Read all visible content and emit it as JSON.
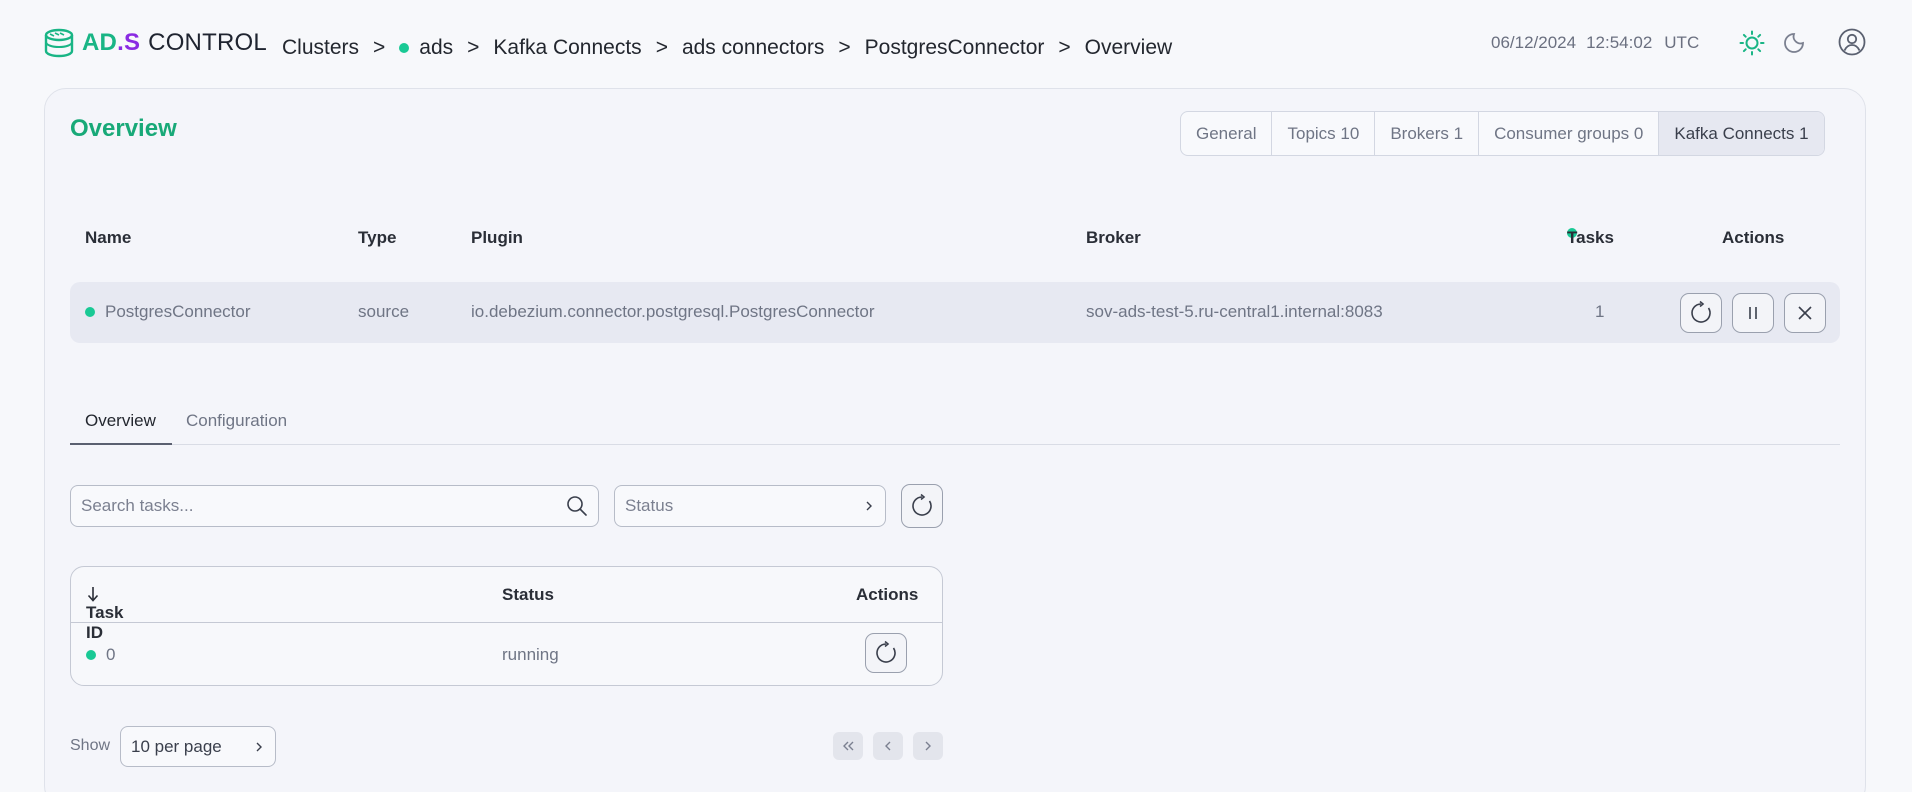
{
  "app": {
    "logo_ad": "AD",
    "logo_s": ".S",
    "logo_control": "CONTROL"
  },
  "breadcrumb": {
    "items": [
      "Clusters",
      "ads",
      "Kafka Connects",
      "ads connectors",
      "PostgresConnector",
      "Overview"
    ],
    "separator": ">"
  },
  "header": {
    "date": "06/12/2024",
    "time": "12:54:02",
    "timezone": "UTC"
  },
  "page": {
    "title": "Overview"
  },
  "segments": [
    {
      "label": "General"
    },
    {
      "label": "Topics 10"
    },
    {
      "label": "Brokers 1"
    },
    {
      "label": "Consumer groups 0"
    },
    {
      "label": "Kafka Connects 1"
    }
  ],
  "connector_table": {
    "headers": {
      "name": "Name",
      "type": "Type",
      "plugin": "Plugin",
      "broker": "Broker",
      "tasks": "Tasks",
      "actions": "Actions"
    },
    "row": {
      "name": "PostgresConnector",
      "type": "source",
      "plugin": "io.debezium.connector.postgresql.PostgresConnector",
      "broker": "sov-ads-test-5.ru-central1.internal:8083",
      "tasks": "1"
    }
  },
  "tabs": {
    "overview": "Overview",
    "configuration": "Configuration"
  },
  "filters": {
    "search_placeholder": "Search tasks...",
    "status_placeholder": "Status"
  },
  "tasks_table": {
    "headers": {
      "task_id": "Task ID",
      "status": "Status",
      "actions": "Actions"
    },
    "rows": [
      {
        "task_id": "0",
        "status": "running"
      }
    ]
  },
  "pagination": {
    "show_label": "Show",
    "per_page": "10 per page"
  },
  "colors": {
    "accent": "#18a978",
    "status_ok": "#19c995",
    "brand_purple": "#8a2be2"
  }
}
